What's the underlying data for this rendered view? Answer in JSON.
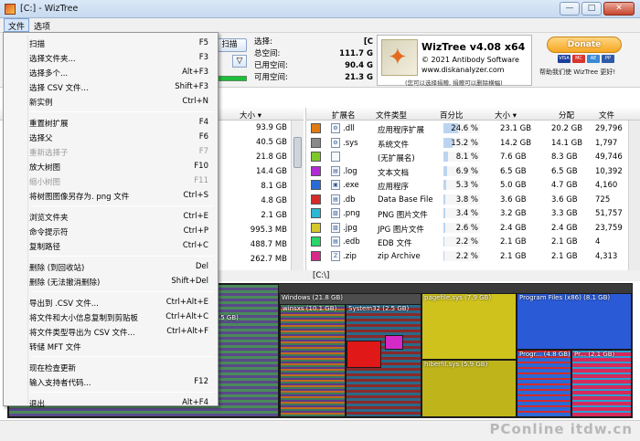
{
  "window": {
    "title": "[C:]  - WizTree",
    "btn_min": "—",
    "btn_max": "□",
    "btn_close": "✕"
  },
  "menubar": {
    "file": "文件",
    "options": "选项"
  },
  "toolbar": {
    "scan": "扫描",
    "filter": "▽"
  },
  "stats": [
    {
      "label": "选择:",
      "value": "[C"
    },
    {
      "label": "总空间:",
      "value": "111.7 G"
    },
    {
      "label": "已用空间:",
      "value": "90.4 G"
    },
    {
      "label": "可用空间:",
      "value": "21.3 G"
    }
  ],
  "about": {
    "title": "WizTree v4.08 x64",
    "copyright": "© 2021 Antibody Software",
    "url": "www.diskanalyzer.com",
    "note": "(您可以选择捐赠, 捐赠可以删除横幅)"
  },
  "donate": {
    "label": "Donate",
    "note": "帮助我们使 WizTree 更好!",
    "cards": [
      "VISA",
      "MC",
      "AE",
      "PP"
    ]
  },
  "tree": {
    "size_header": "大小 ▾",
    "sizes": [
      "93.9 GB",
      "40.5 GB",
      "21.8 GB",
      "14.4 GB",
      "8.1 GB",
      "4.8 GB",
      "2.1 GB",
      "995.3 MB",
      "488.7 MB",
      "262.7 MB"
    ]
  },
  "typelist": {
    "headers": {
      "ext": "扩展名",
      "type": "文件类型",
      "pct": "百分比",
      "size": "大小 ▾",
      "alloc": "分配",
      "files": "文件"
    },
    "rows": [
      {
        "color": "#e07b14",
        "icon": "⚙",
        "ext": ".dll",
        "type": "应用程序扩展",
        "pct": "24.6 %",
        "pct_val": 24.6,
        "size": "23.1 GB",
        "alloc": "20.2 GB",
        "files": "29,796"
      },
      {
        "color": "#8a8a8a",
        "icon": "⚙",
        "ext": ".sys",
        "type": "系统文件",
        "pct": "15.2 %",
        "pct_val": 15.2,
        "size": "14.2 GB",
        "alloc": "14.1 GB",
        "files": "1,797"
      },
      {
        "color": "#7ec82a",
        "icon": "",
        "ext": "",
        "type": "(无扩展名)",
        "pct": "8.1 %",
        "pct_val": 8.1,
        "size": "7.6 GB",
        "alloc": "8.3 GB",
        "files": "49,746"
      },
      {
        "color": "#b22ad6",
        "icon": "▤",
        "ext": ".log",
        "type": "文本文档",
        "pct": "6.9 %",
        "pct_val": 6.9,
        "size": "6.5 GB",
        "alloc": "6.5 GB",
        "files": "10,392"
      },
      {
        "color": "#2a6ad6",
        "icon": "▣",
        "ext": ".exe",
        "type": "应用程序",
        "pct": "5.3 %",
        "pct_val": 5.3,
        "size": "5.0 GB",
        "alloc": "4.7 GB",
        "files": "4,160"
      },
      {
        "color": "#d62a2a",
        "icon": "▤",
        "ext": ".db",
        "type": "Data Base File",
        "pct": "3.8 %",
        "pct_val": 3.8,
        "size": "3.6 GB",
        "alloc": "3.6 GB",
        "files": "725"
      },
      {
        "color": "#2ab8d6",
        "icon": "▨",
        "ext": ".png",
        "type": "PNG 图片文件",
        "pct": "3.4 %",
        "pct_val": 3.4,
        "size": "3.2 GB",
        "alloc": "3.3 GB",
        "files": "51,757"
      },
      {
        "color": "#d6c82a",
        "icon": "▨",
        "ext": ".jpg",
        "type": "JPG 图片文件",
        "pct": "2.6 %",
        "pct_val": 2.6,
        "size": "2.4 GB",
        "alloc": "2.4 GB",
        "files": "23,759"
      },
      {
        "color": "#2ad66a",
        "icon": "▤",
        "ext": ".edb",
        "type": "EDB 文件",
        "pct": "2.2 %",
        "pct_val": 2.2,
        "size": "2.1 GB",
        "alloc": "2.1 GB",
        "files": "4"
      },
      {
        "color": "#d62a8a",
        "icon": "Z",
        "ext": ".zip",
        "type": "zip Archive",
        "pct": "2.2 %",
        "pct_val": 2.2,
        "size": "2.1 GB",
        "alloc": "2.1 GB",
        "files": "4,313"
      }
    ]
  },
  "path": "[C:\\]",
  "treemap": {
    "labels": {
      "windows": "Windows (21.8 GB)",
      "winsxs": "winsxs (10.1 GB)",
      "system32": "System32 (2.5 GB)",
      "pagefile": "pagefile.sys (7.9 GB)",
      "hiberfil": "hiberfil.sys (5.9 GB)",
      "programfiles": "Program Files (x86) (8.1 GB)",
      "progr": "Progr... (4.8 GB)",
      "pr": "Pr... (2.1 GB)",
      "left": ".5 GB)"
    }
  },
  "menu": {
    "items": [
      {
        "label": "扫描",
        "key": "F5"
      },
      {
        "label": "选择文件夹...",
        "key": "F3"
      },
      {
        "label": "选择多个...",
        "key": "Alt+F3"
      },
      {
        "label": "选择 CSV 文件...",
        "key": "Shift+F3"
      },
      {
        "label": "新实例",
        "key": "Ctrl+N"
      },
      {
        "label": "重置树扩展",
        "key": "F4"
      },
      {
        "label": "选择父",
        "key": "F6"
      },
      {
        "label": "重新选择子",
        "key": "F7"
      },
      {
        "label": "放大树图",
        "key": "F10"
      },
      {
        "label": "缩小树图",
        "key": "F11"
      },
      {
        "label": "将树图图像另存为. png 文件",
        "key": "Ctrl+S"
      },
      {
        "label": "浏览文件夹",
        "key": "Ctrl+E"
      },
      {
        "label": "命令提示符",
        "key": "Ctrl+P"
      },
      {
        "label": "复制路径",
        "key": "Ctrl+C"
      },
      {
        "label": "删除 (到回收站)",
        "key": "Del"
      },
      {
        "label": "删除 (无法撤消删除)",
        "key": "Shift+Del"
      },
      {
        "label": "导出到 .CSV 文件...",
        "key": "Ctrl+Alt+E"
      },
      {
        "label": "将文件和大小信息复制到剪贴板",
        "key": "Ctrl+Alt+C"
      },
      {
        "label": "将文件类型导出为 CSV 文件...",
        "key": "Ctrl+Alt+F"
      },
      {
        "label": "转储 MFT 文件",
        "key": ""
      },
      {
        "label": "现在检查更新",
        "key": ""
      },
      {
        "label": "输入支持者代码...",
        "key": "F12"
      },
      {
        "label": "退出",
        "key": "Alt+F4"
      }
    ]
  },
  "watermark": "PConline  itdw.cn"
}
